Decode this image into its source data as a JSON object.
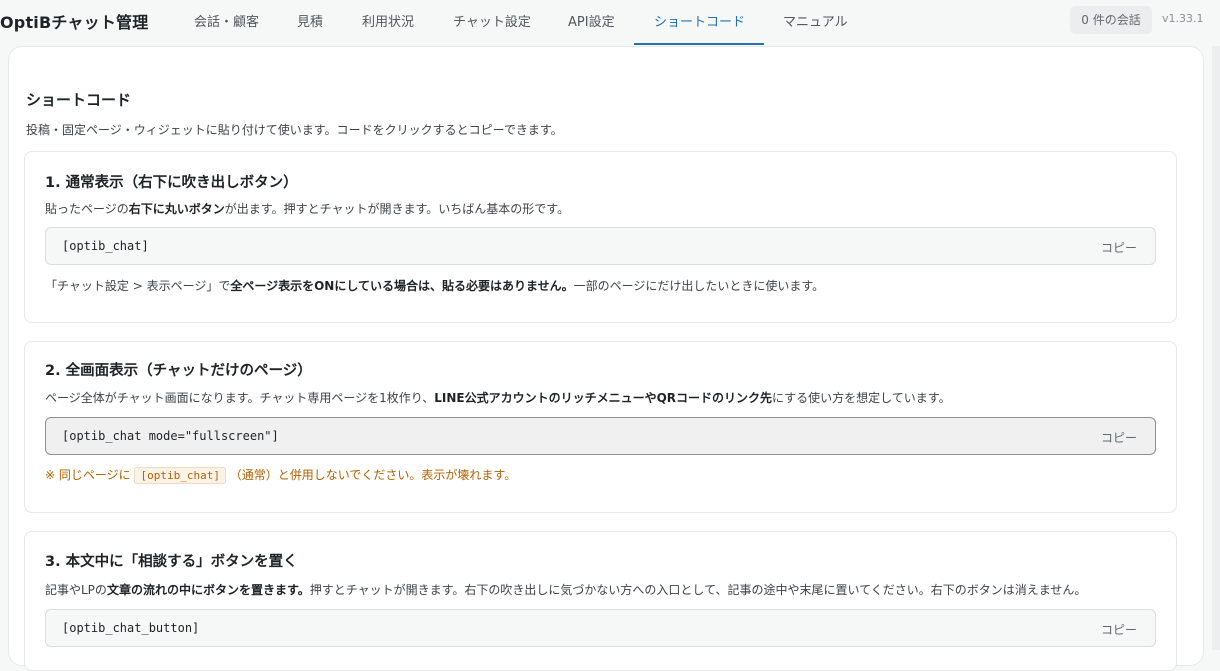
{
  "header": {
    "brand": "OptiBチャット管理",
    "tabs": [
      "会話・顧客",
      "見積",
      "利用状況",
      "チャット設定",
      "API設定",
      "ショートコード",
      "マニュアル"
    ],
    "active_tab": "ショートコード",
    "conversations_badge": "0 件の会話",
    "version": "v1.33.1"
  },
  "page": {
    "title": "ショートコード",
    "description": "投稿・固定ページ・ウィジェットに貼り付けて使います。コードをクリックするとコピーできます。"
  },
  "cards": [
    {
      "title": "1. 通常表示（右下に吹き出しボタン）",
      "desc_1": "貼ったページの",
      "desc_bold": "右下に丸いボタン",
      "desc_2": "が出ます。押すとチャットが開きます。いちばん基本の形です。",
      "code": "[optib_chat]",
      "copy_label": "コピー",
      "note_1": "「チャット設定 > 表示ページ」で",
      "note_bold": "全ページ表示をONにしている場合は、貼る必要はありません。",
      "note_2": "一部のページにだけ出したいときに使います。"
    },
    {
      "title": "2. 全画面表示（チャットだけのページ）",
      "desc_1": "ページ全体がチャット画面になります。チャット専用ページを1枚作り、",
      "desc_bold": "LINE公式アカウントのリッチメニューやQRコードのリンク先",
      "desc_2": "にする使い方を想定しています。",
      "code": "[optib_chat mode=\"fullscreen\"]",
      "copy_label": "コピー",
      "warn_1": "※ 同じページに",
      "warn_code": "[optib_chat]",
      "warn_2": "（通常）と併用しないでください。表示が壊れます。"
    },
    {
      "title": "3. 本文中に「相談する」ボタンを置く",
      "desc_1": "記事やLPの",
      "desc_bold": "文章の流れの中にボタンを置きます。",
      "desc_2": "押すとチャットが開きます。右下の吹き出しに気づかない方への入口として、記事の途中や末尾に置いてください。右下のボタンは消えません。",
      "code": "[optib_chat_button]",
      "copy_label": "コピー"
    }
  ],
  "colors": {
    "accent": "#2271b1",
    "warning": "#b26200",
    "background": "#f6f7f7"
  }
}
